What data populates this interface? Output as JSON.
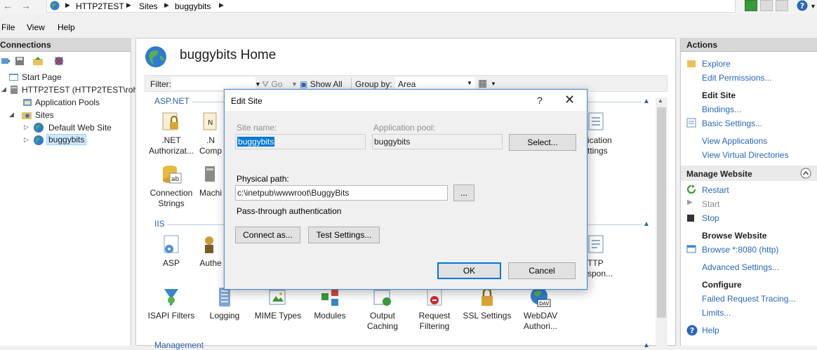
{
  "address": {
    "breadcrumb": [
      "HTTP2TEST",
      "Sites",
      "buggybits"
    ]
  },
  "menu": [
    "File",
    "View",
    "Help"
  ],
  "connections": {
    "title": "Connections",
    "tree": {
      "start_page": "Start Page",
      "server": "HTTP2TEST (HTTP2TEST\\roh",
      "app_pools": "Application Pools",
      "sites": "Sites",
      "default_site": "Default Web Site",
      "buggybits": "buggybits"
    }
  },
  "main": {
    "title": "buggybits Home",
    "filterbar": {
      "filter_label": "Filter:",
      "go_label": "Go",
      "show_all_label": "Show All",
      "group_by_label": "Group by:",
      "group_by_value": "Area"
    },
    "groups": {
      "aspnet": "ASP.NET",
      "iis": "IIS",
      "management": "Management"
    },
    "aspnet_features": [
      {
        "line1": ".NET",
        "line2": "Authorizat..."
      },
      {
        "line1": ".N",
        "line2": "Comp"
      },
      {
        "line1": "ication",
        "line2": "ttings"
      }
    ],
    "aspnet_row2": [
      {
        "line1": "Connection",
        "line2": "Strings"
      },
      {
        "line1": "Machi",
        "line2": ""
      }
    ],
    "iis_row1": [
      {
        "line1": "ASP",
        "line2": ""
      },
      {
        "line1": "Authe",
        "line2": ""
      },
      {
        "line1": "TTP",
        "line2": "spon..."
      }
    ],
    "iis_row2": [
      {
        "line1": "ISAPI Filters",
        "line2": ""
      },
      {
        "line1": "Logging",
        "line2": ""
      },
      {
        "line1": "MIME Types",
        "line2": ""
      },
      {
        "line1": "Modules",
        "line2": ""
      },
      {
        "line1": "Output",
        "line2": "Caching"
      },
      {
        "line1": "Request",
        "line2": "Filtering"
      },
      {
        "line1": "SSL Settings",
        "line2": ""
      },
      {
        "line1": "WebDAV",
        "line2": "Authori..."
      }
    ]
  },
  "actions": {
    "title": "Actions",
    "explore": "Explore",
    "edit_permissions": "Edit Permissions...",
    "edit_site_header": "Edit Site",
    "bindings": "Bindings...",
    "basic_settings": "Basic Settings...",
    "view_applications": "View Applications",
    "view_virtual_directories": "View Virtual Directories",
    "manage_website_header": "Manage Website",
    "restart": "Restart",
    "start": "Start",
    "stop": "Stop",
    "browse_website_header": "Browse Website",
    "browse_8080": "Browse *:8080 (http)",
    "advanced_settings": "Advanced Settings...",
    "configure_header": "Configure",
    "failed_request_tracing": "Failed Request Tracing...",
    "limits": "Limits...",
    "help": "Help"
  },
  "dialog": {
    "title": "Edit Site",
    "help_glyph": "?",
    "close_glyph": "✕",
    "site_name_label": "Site name:",
    "site_name_value": "buggybits",
    "app_pool_label": "Application pool:",
    "app_pool_value": "buggybits",
    "select_button": "Select...",
    "physical_path_label": "Physical path:",
    "physical_path_value": "c:\\inetpub\\wwwroot\\BuggyBits",
    "browse_button": "...",
    "passthrough_label": "Pass-through authentication",
    "connect_as_button": "Connect as...",
    "test_settings_button": "Test Settings...",
    "ok_button": "OK",
    "cancel_button": "Cancel"
  }
}
